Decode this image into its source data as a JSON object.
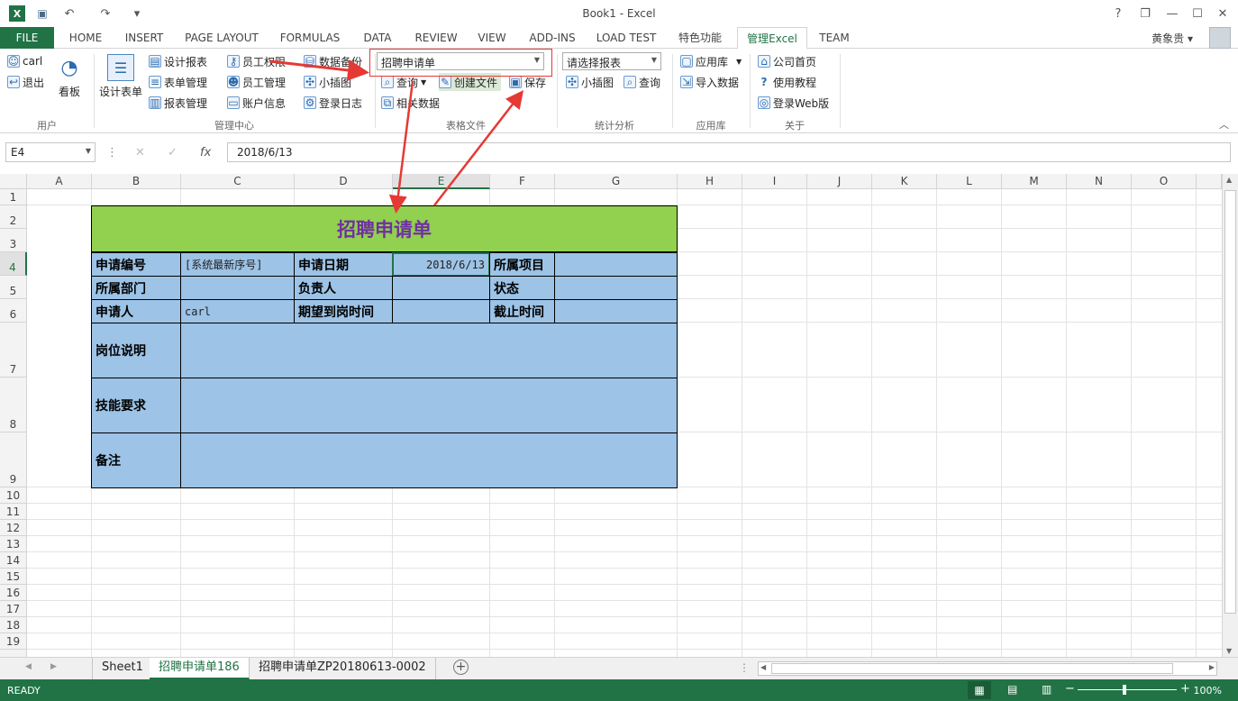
{
  "titlebar": {
    "title": "Book1 - Excel",
    "help": "?",
    "restore": "❐",
    "minimize": "—",
    "maximize": "☐",
    "close": "✕",
    "qat_undo": "↶",
    "qat_redo": "↷",
    "qat_more": "▾"
  },
  "tabs": [
    {
      "label": "FILE"
    },
    {
      "label": "HOME"
    },
    {
      "label": "INSERT"
    },
    {
      "label": "PAGE LAYOUT"
    },
    {
      "label": "FORMULAS"
    },
    {
      "label": "DATA"
    },
    {
      "label": "REVIEW"
    },
    {
      "label": "VIEW"
    },
    {
      "label": "ADD-INS"
    },
    {
      "label": "LOAD TEST"
    },
    {
      "label": "特色功能"
    },
    {
      "label": "管理Excel"
    },
    {
      "label": "TEAM"
    }
  ],
  "user": {
    "name": "黄象贵 ▾"
  },
  "ribbon": {
    "user_group": {
      "label": "用户",
      "login": "carl",
      "logout": "退出",
      "board": "看板"
    },
    "manage_group": {
      "label": "管理中心",
      "design_form": "设计表单",
      "design_report": "设计报表",
      "form_manage": "表单管理",
      "report_manage": "报表管理",
      "emp_perm": "员工权限",
      "emp_manage": "员工管理",
      "account_info": "账户信息",
      "backup": "数据备份",
      "small_plugin": "小插图",
      "login_log": "登录日志"
    },
    "file_group": {
      "label": "表格文件",
      "combo_value": "招聘申请单",
      "query": "查询",
      "create_file": "创建文件",
      "save": "保存",
      "related": "相关数据"
    },
    "stats_group": {
      "label": "统计分析",
      "combo_value": "请选择报表",
      "small_plugin": "小插图",
      "query": "查询"
    },
    "app_group": {
      "label": "应用库",
      "app_lib": "应用库",
      "import": "导入数据"
    },
    "about_group": {
      "label": "关于",
      "home": "公司首页",
      "tutorial": "使用教程",
      "web_login": "登录Web版"
    }
  },
  "formula": {
    "namebox": "E4",
    "value": "2018/6/13",
    "fx": "fx",
    "cancel": "✕",
    "confirm": "✓",
    "dots": "⋮"
  },
  "columns": [
    "A",
    "B",
    "C",
    "D",
    "E",
    "F",
    "G",
    "H",
    "I",
    "J",
    "K",
    "L",
    "M",
    "N",
    "O"
  ],
  "rows": [
    "1",
    "2",
    "3",
    "4",
    "5",
    "6",
    "7",
    "8",
    "9",
    "10",
    "11",
    "12",
    "13",
    "14",
    "15",
    "16",
    "17",
    "18",
    "19"
  ],
  "form": {
    "title": "招聘申请单",
    "r4": [
      "申请编号",
      "[系统最新序号]",
      "申请日期",
      "2018/6/13",
      "所属项目"
    ],
    "r5": [
      "所属部门",
      "负责人",
      "状态"
    ],
    "r6": [
      "申请人",
      "carl",
      "期望到岗时间",
      "截止时间"
    ],
    "r7": "岗位说明",
    "r8": "技能要求",
    "r9": "备注"
  },
  "sheets": [
    {
      "label": "Sheet1"
    },
    {
      "label": "招聘申请单186"
    },
    {
      "label": "招聘申请单ZP20180613-0002"
    }
  ],
  "status": {
    "ready": "READY",
    "zoom": "100%",
    "add_sheet": "+"
  }
}
